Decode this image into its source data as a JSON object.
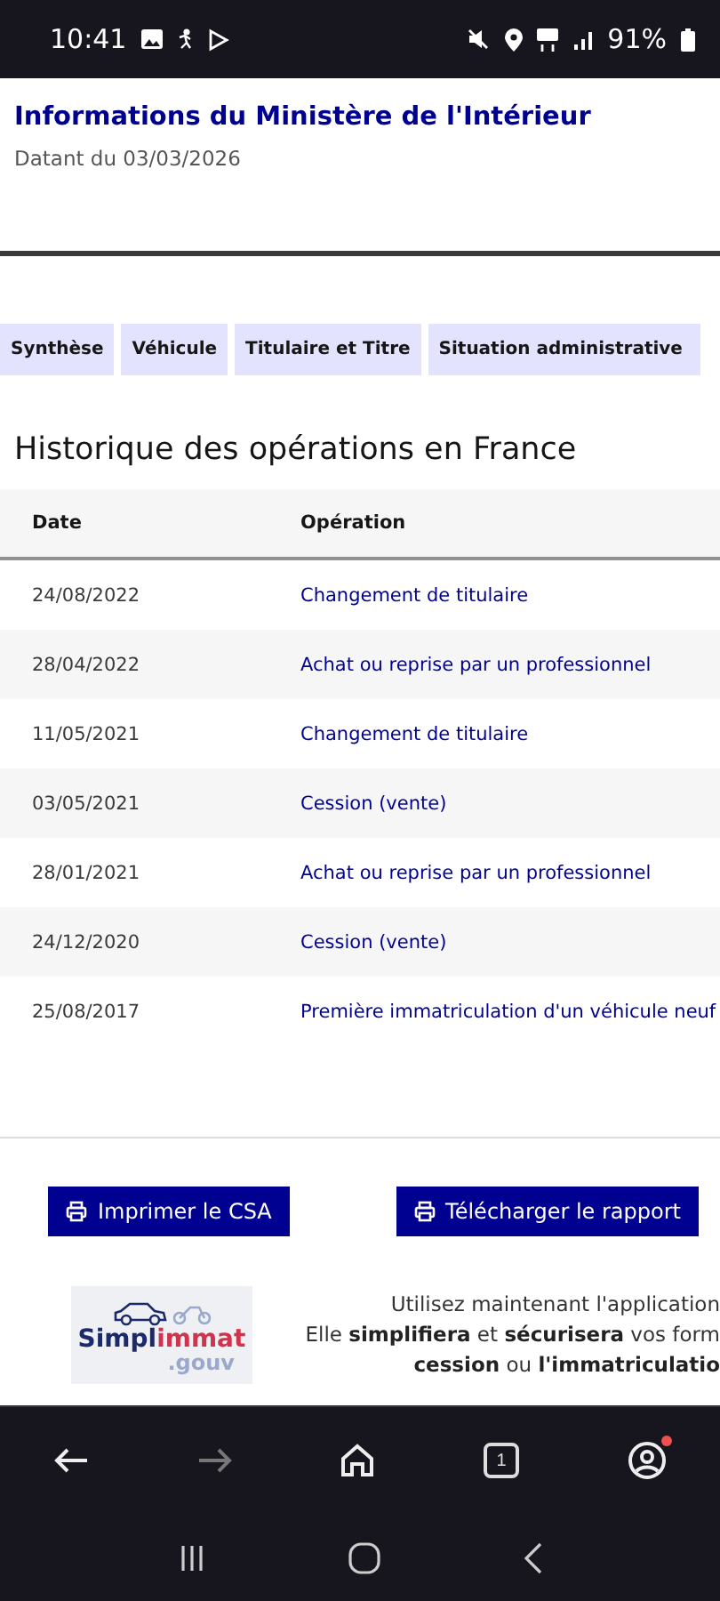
{
  "status_bar": {
    "time": "10:41",
    "battery": "91%"
  },
  "header": {
    "title": "Informations du Ministère de l'Intérieur",
    "date": "Datant du 03/03/2026"
  },
  "tabs": [
    {
      "label": "Synthèse"
    },
    {
      "label": "Véhicule"
    },
    {
      "label": "Titulaire et Titre"
    },
    {
      "label": "Situation administrative"
    }
  ],
  "section_title": "Historique des opérations en France",
  "table": {
    "columns": [
      "Date",
      "Opération"
    ],
    "rows": [
      {
        "date": "24/08/2022",
        "operation": "Changement de titulaire"
      },
      {
        "date": "28/04/2022",
        "operation": "Achat ou reprise par un professionnel"
      },
      {
        "date": "11/05/2021",
        "operation": "Changement de titulaire"
      },
      {
        "date": "03/05/2021",
        "operation": "Cession (vente)"
      },
      {
        "date": "28/01/2021",
        "operation": "Achat ou reprise par un professionnel"
      },
      {
        "date": "24/12/2020",
        "operation": "Cession (vente)"
      },
      {
        "date": "25/08/2017",
        "operation": "Première immatriculation d'un véhicule neuf"
      }
    ]
  },
  "buttons": [
    "Imprimer le CSA",
    "Télécharger le rapport"
  ],
  "promo": {
    "logo": {
      "name_start": "Simpl",
      "name_end": "immat",
      "domain": ".gouv"
    },
    "lines": [
      "Utilisez maintenant l'application",
      "Elle **simplifiera** et **sécurisera** vos form",
      "**cession** ou **l'immatriculatio**"
    ]
  },
  "browser_bar": {
    "tab_count": "1",
    "account_notification": true
  }
}
